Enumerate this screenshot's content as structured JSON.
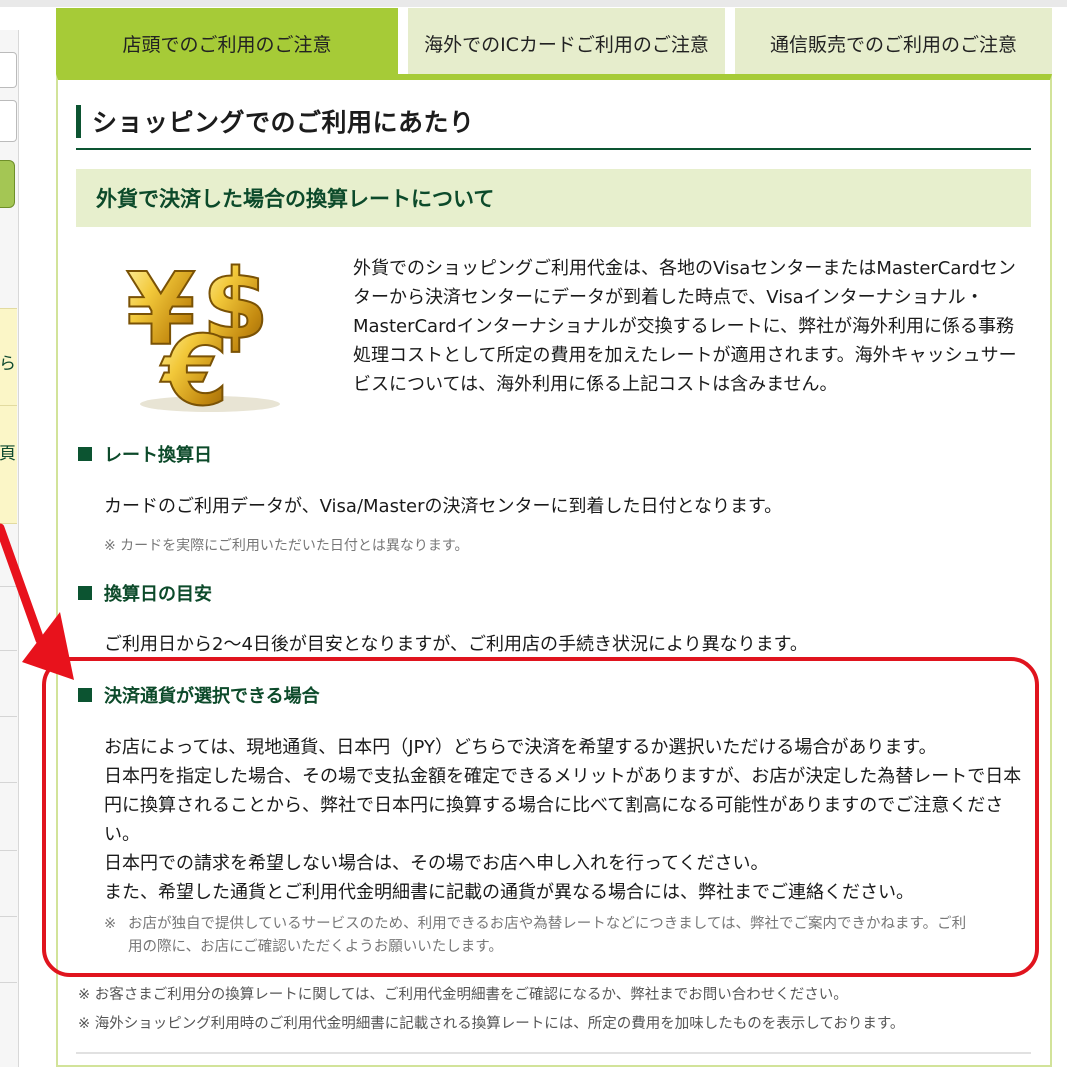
{
  "tabs": [
    {
      "label": "店頭でのご利用のご注意",
      "active": true
    },
    {
      "label": "海外でのICカードご利用のご注意",
      "active": false
    },
    {
      "label": "通信販売でのご利用のご注意",
      "active": false
    }
  ],
  "sidebar": {
    "visible_chars": [
      "ら",
      "頁"
    ]
  },
  "section": {
    "title": "ショッピングでのご利用にあたり",
    "subtitle": "外貨で決済した場合の換算レートについて",
    "icon": "currency-yen-dollar-euro-icon",
    "intro_lines": [
      "外貨でのショッピングご利用代金は、各地のVisaセンターまたはMasterCardセン",
      "ターから決済センターにデータが到着した時点で、Visaインターナショナル・",
      "MasterCardインターナショナルが交換するレートに、弊社が海外利用に係る事務",
      "処理コストとして所定の費用を加えたレートが適用されます。海外キャッシュサー",
      "ビスについては、海外利用に係る上記コストは含みません。"
    ]
  },
  "items": {
    "rate_date": {
      "heading": "レート換算日",
      "body": "カードのご利用データが、Visa/Masterの決済センターに到着した日付となります。",
      "note": "※ カードを実際にご利用いただいた日付とは異なります。"
    },
    "estimate": {
      "heading": "換算日の目安",
      "body": "ご利用日から2～4日後が目安となりますが、ご利用店の手続き状況により異なります。"
    },
    "currency_choice": {
      "heading": "決済通貨が選択できる場合",
      "lines": [
        "お店によっては、現地通貨、日本円（JPY）どちらで決済を希望するか選択いただける場合があります。",
        "日本円を指定した場合、その場で支払金額を確定できるメリットがありますが、お店が決定した為替レートで日本",
        "円に換算されることから、弊社で日本円に換算する場合に比べて割高になる可能性がありますのでご注意くださ",
        "い。",
        "日本円での請求を希望しない場合は、その場でお店へ申し入れを行ってください。",
        "また、希望した通貨とご利用代金明細書に記載の通貨が異なる場合には、弊社までご連絡ください。"
      ],
      "note_mark": "※",
      "note_lines": [
        "お店が独自で提供しているサービスのため、利用できるお店や為替レートなどにつきましては、弊社でご案内できかねます。ご利",
        "用の際に、お店にご確認いただくようお願いいたします。"
      ]
    }
  },
  "footnotes": [
    "※ お客さまご利用分の換算レートに関しては、ご利用代金明細書をご確認になるか、弊社までお問い合わせください。",
    "※ 海外ショッピング利用時のご利用代金明細書に記載される換算レートには、所定の費用を加味したものを表示しております。"
  ],
  "colors": {
    "tab_active": "#a6cb37",
    "tab_inactive": "#e6edcc",
    "heading_green": "#0c5431",
    "highlight_red": "#e0141e"
  }
}
